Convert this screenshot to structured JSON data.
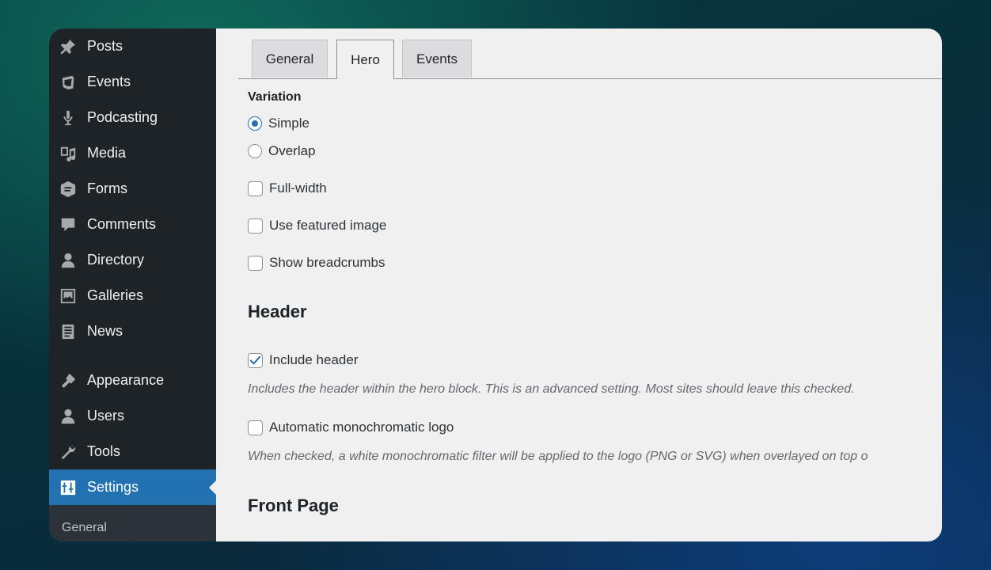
{
  "sidebar": {
    "items": [
      {
        "label": "Posts",
        "icon": "pin-icon"
      },
      {
        "label": "Events",
        "icon": "calendar-icon"
      },
      {
        "label": "Podcasting",
        "icon": "microphone-icon"
      },
      {
        "label": "Media",
        "icon": "media-icon"
      },
      {
        "label": "Forms",
        "icon": "forms-icon"
      },
      {
        "label": "Comments",
        "icon": "comment-icon"
      },
      {
        "label": "Directory",
        "icon": "person-icon"
      },
      {
        "label": "Galleries",
        "icon": "gallery-icon"
      },
      {
        "label": "News",
        "icon": "document-icon"
      },
      {
        "label": "Appearance",
        "icon": "brush-icon"
      },
      {
        "label": "Users",
        "icon": "users-icon"
      },
      {
        "label": "Tools",
        "icon": "wrench-icon"
      },
      {
        "label": "Settings",
        "icon": "settings-icon"
      }
    ],
    "active": "Settings",
    "submenu": {
      "label": "General"
    }
  },
  "tabs": [
    {
      "label": "General"
    },
    {
      "label": "Hero"
    },
    {
      "label": "Events"
    }
  ],
  "active_tab": "Hero",
  "variation": {
    "label": "Variation",
    "options": [
      {
        "label": "Simple",
        "checked": true
      },
      {
        "label": "Overlap",
        "checked": false
      }
    ]
  },
  "checkboxes": {
    "full_width": {
      "label": "Full-width",
      "checked": false
    },
    "featured_image": {
      "label": "Use featured image",
      "checked": false
    },
    "breadcrumbs": {
      "label": "Show breadcrumbs",
      "checked": false
    }
  },
  "header_section": {
    "title": "Header",
    "include_header": {
      "label": "Include header",
      "checked": true
    },
    "include_header_desc": "Includes the header within the hero block. This is an advanced setting. Most sites should leave this checked.",
    "mono_logo": {
      "label": "Automatic monochromatic logo",
      "checked": false
    },
    "mono_logo_desc": "When checked, a white monochromatic filter will be applied to the logo (PNG or SVG) when overlayed on top o"
  },
  "front_page_section": {
    "title": "Front Page"
  },
  "colors": {
    "sidebar_bg": "#1d2327",
    "accent": "#2271b1",
    "content_bg": "#f0f0f1"
  }
}
